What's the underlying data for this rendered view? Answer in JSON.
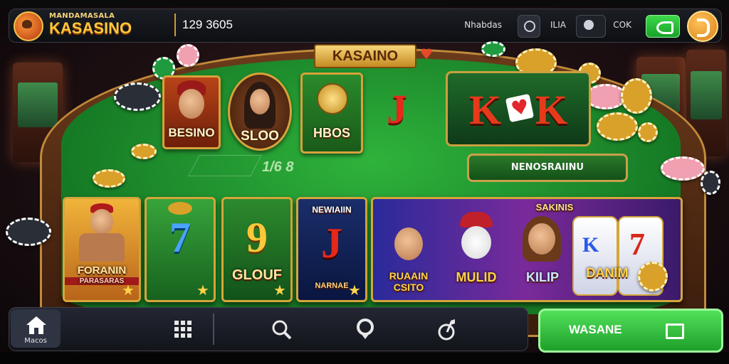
{
  "header": {
    "brand_subtitle": "MANDAMASALA",
    "brand_name": "KASASINO",
    "balance": "129 3605",
    "menu_label": "Nhabdas",
    "info_label": "ILIA",
    "ok_label": "COK"
  },
  "table": {
    "title": "KASAINO",
    "score": "1/6 8",
    "banner": "NENOSRAIINU",
    "tiles": [
      {
        "label": "BESINO"
      },
      {
        "label": "SLOO"
      },
      {
        "label": "HBOS"
      }
    ],
    "jack": "J",
    "kk": "KK"
  },
  "games": [
    {
      "label_top": "",
      "label": "FORANIN",
      "sublabel": "PARASARAS"
    },
    {
      "label_top": "",
      "symbol": "7",
      "label": ""
    },
    {
      "label_top": "",
      "symbol": "9",
      "label": "GLOUF"
    },
    {
      "label_top": "NEWIAIIN",
      "symbol": "J",
      "label": "NARNAE"
    },
    {
      "label_top": "SAKINIS",
      "items": [
        "RUAAIN CSITO",
        "MULID",
        "KILIP",
        "DANIM"
      ]
    }
  ],
  "nav": {
    "home_label": "Macos"
  },
  "cta": {
    "label": "WASANE"
  },
  "colors": {
    "felt": "#2fb33c",
    "gold": "#d6a23a",
    "cta_green": "#1ea02a"
  }
}
